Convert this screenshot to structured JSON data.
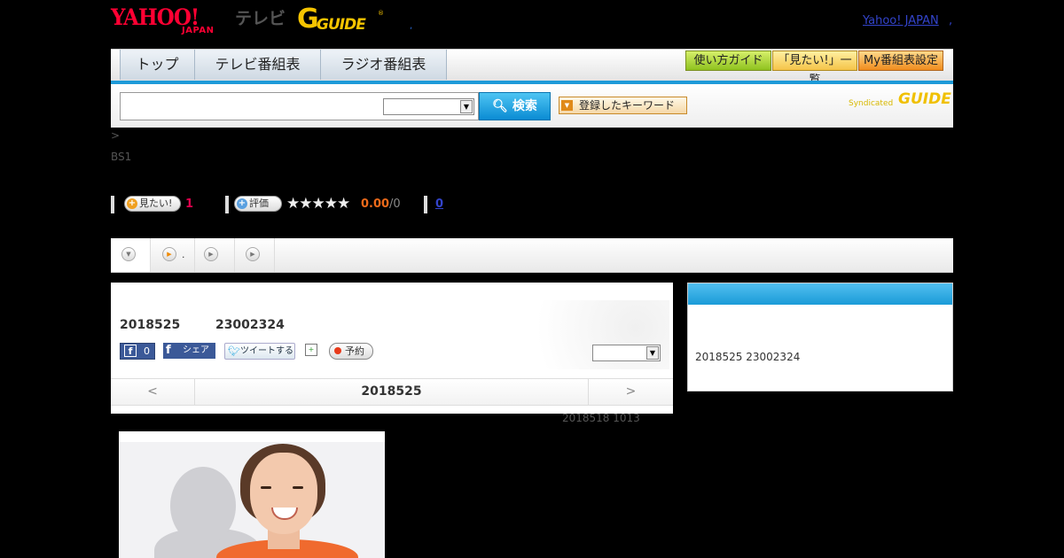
{
  "header": {
    "yahoo_logo": "YAHOO!",
    "japan_logo": "JAPAN",
    "tv_label": "テレビ",
    "gguide_g": "G",
    "gguide_logo": "GUIDE",
    "gguide_reg": "®",
    "sep_dot": ",",
    "yahoo_japan_link": "Yahoo! JAPAN",
    "right_dot": ","
  },
  "nav": {
    "tabs": [
      "トップ",
      "テレビ番組表",
      "ラジオ番組表"
    ],
    "right_buttons": [
      "使い方ガイド",
      "「見たい!」一覧",
      "My番組表設定"
    ]
  },
  "search": {
    "input_value": "",
    "select_value": "",
    "button_label": "検索",
    "keyword_button": "登録したキーワード",
    "syndicated": "Syndicated",
    "synd_logo": "GUIDE"
  },
  "breadcrumb": ">",
  "station": "BS1",
  "rating": {
    "want_label": "見たい!",
    "want_count": "1",
    "rate_label": "評価",
    "stars": "★★★★★",
    "score": "0.00",
    "score_of": "/0",
    "review_count": "0"
  },
  "subtabs": [
    {
      "label": ""
    },
    {
      "label": "."
    },
    {
      "label": ""
    },
    {
      "label": ""
    }
  ],
  "program": {
    "date": "2018525",
    "time": "23002324",
    "fb_count": "0",
    "fb_share": "シェア",
    "tweet": "ツイートする",
    "reserve": "予約",
    "select_value": ""
  },
  "datenav": {
    "prev": "<",
    "current": "2018525",
    "next": ">"
  },
  "updated": "2018518  1013",
  "side": {
    "text": "2018525  23002324"
  },
  "colors": {
    "accent_blue": "#1d9ad8",
    "yahoo_red": "#ff0033",
    "gguide_yellow": "#f5c400"
  }
}
